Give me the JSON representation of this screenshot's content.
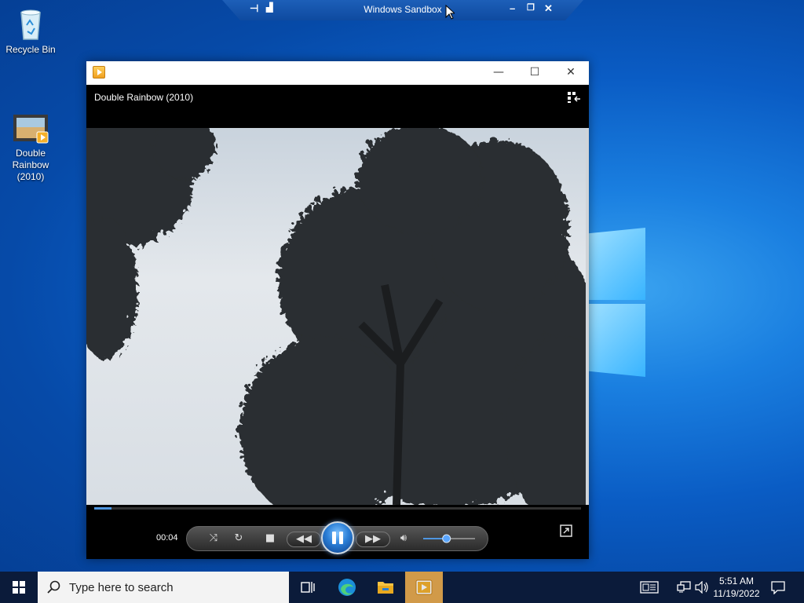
{
  "desktop": {
    "icons": [
      {
        "label": "Recycle Bin",
        "icon": "recycle-bin-icon"
      },
      {
        "label": "Double\nRainbow\n(2010)",
        "icon": "video-file-icon"
      }
    ]
  },
  "sandbox_bar": {
    "title": "Windows Sandbox",
    "left_icons": [
      "pin-icon",
      "signal-icon"
    ],
    "right_controls": [
      "minimize",
      "restore",
      "close"
    ]
  },
  "player": {
    "window_controls": {
      "minimize": "—",
      "maximize": "☐",
      "close": "✕"
    },
    "video_title": "Double Rainbow (2010)",
    "current_time": "00:04",
    "progress": 0.035,
    "volume": 0.45,
    "controls": [
      "shuffle-icon",
      "repeat-icon",
      "stop-icon",
      "rewind-icon",
      "pause-icon",
      "fast-forward-icon",
      "volume-icon",
      "fullscreen-icon"
    ],
    "accent": "#2a7ed6"
  },
  "taskbar": {
    "search_placeholder": "Type here to search",
    "pinned_apps": [
      "task-view-icon",
      "edge-icon",
      "file-explorer-icon",
      "media-player-icon"
    ],
    "time": "5:51 AM",
    "date": "11/19/2022",
    "tray_icons": [
      "news-icon",
      "network-icon",
      "volume-icon",
      "notifications-icon"
    ]
  }
}
